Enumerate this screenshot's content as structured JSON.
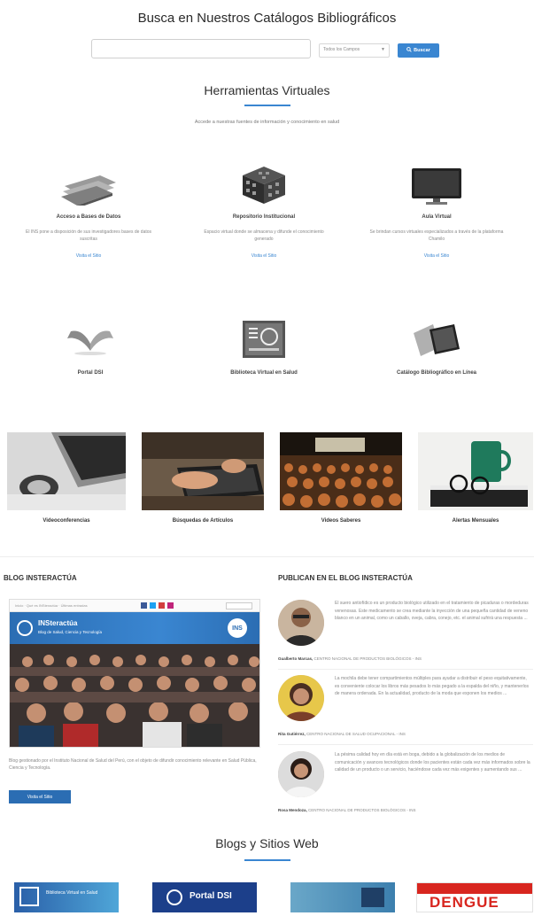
{
  "search": {
    "title": "Busca en Nuestros Catálogos Bibliográficos",
    "placeholder": "",
    "select_value": "Todos los Campos",
    "button_label": "Buscar"
  },
  "tools_section": {
    "title": "Herramientas Virtuales",
    "subtitle": "Accede a nuestras fuentes de información y conocimiento en salud",
    "row1": [
      {
        "name": "Acceso a Bases de Datos",
        "desc": "El INS pone a disposición de sus investigadores bases de datos suscritas",
        "link": "Visita el Sitio"
      },
      {
        "name": "Repositorio Institucional",
        "desc": "Espacio virtual donde se almacena y difunde el conocimiento generado",
        "link": "Visita el Sitio"
      },
      {
        "name": "Aula Virtual",
        "desc": "Se brindan cursos virtuales especializados a través de la plataforma Chamilo",
        "link": "Visita el Sitio"
      }
    ],
    "row2": [
      {
        "name": "Portal DSI"
      },
      {
        "name": "Biblioteca Virtual en Salud"
      },
      {
        "name": "Catálogo Bibliográfico en Línea"
      }
    ]
  },
  "photo_links": [
    {
      "label": "Videoconferencias"
    },
    {
      "label": "Búsquedas de Artículos"
    },
    {
      "label": "Videos Saberes"
    },
    {
      "label": "Alertas Mensuales"
    }
  ],
  "blog": {
    "heading": "BLOG INSTERACTÚA",
    "shot_nav": "Inicio · Qué es INSteractúa · Últimas entradas",
    "shot_title": "INSteractúa",
    "shot_subtitle": "Blog de Salud, Ciencia y Tecnología",
    "shot_badge": "INS",
    "description": "Blog gestionado por el Instituto Nacional de Salud del Perú, con el objeto de difundir conocimiento relevante en Salud Pública, Ciencia y Tecnología.",
    "button_label": "Visita el Sitio"
  },
  "publican": {
    "heading": "PUBLICAN EN EL BLOG INSTERACTÚA",
    "posts": [
      {
        "text": "El suero antiofídico es un producto biológico utilizado en el tratamiento de picaduras o mordeduras venenosas. Este medicamento se crea mediante la inyección de una pequeña cantidad de veneno blanco en un animal, como un caballo, oveja, cabra, conejo, etc. el animal sufrirá una respuesta ...",
        "author": "Gualberto Marcas,",
        "org": "CENTRO NACIONAL DE PRODUCTOS BIOLÓGICOS - INS"
      },
      {
        "text": "La mochila debe tener compartimientos múltiples para ayudar a distribuir el peso equitativamente, es conveniente colocar los libros más pesados lo más pegado a la espalda del niño, y mantenerlos de manera ordenada. En la actualidad, producto de la moda que exponen los medios ...",
        "author": "Rita Gutiérrez,",
        "org": "CENTRO NACIONAL DE SALUD OCUPACIONAL - INS"
      },
      {
        "text": "La pésima calidad hoy en día está en boga, debido a la globalización de los medios de comunicación y avances tecnológicos donde los pacientes están cada vez más informados sobre la calidad de un producto o un servicio, haciéndose cada vez más exigentes y aumentando sus ...",
        "author": "Rosa Mendoza,",
        "org": "CENTRO NACIONAL DE PRODUCTOS BIOLÓGICOS - INS"
      }
    ]
  },
  "blogs_section": {
    "title": "Blogs y Sitios Web",
    "tiles": [
      {
        "label": "Biblioteca Virtual en Salud"
      },
      {
        "label": "Portal DSI"
      },
      {
        "label": ""
      },
      {
        "label": "DENGUE"
      }
    ]
  },
  "colors": {
    "accent": "#3a86d1",
    "dark_blue": "#2b6db3",
    "dengue_red": "#d8261f"
  }
}
